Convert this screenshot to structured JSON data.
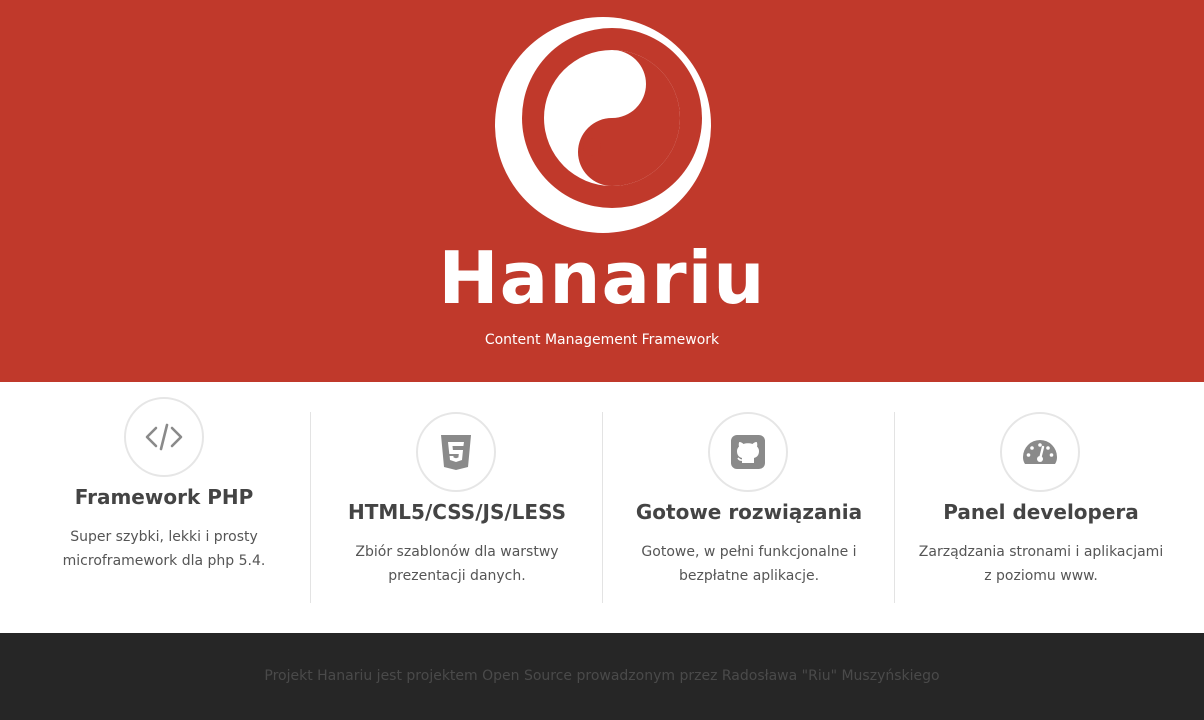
{
  "hero": {
    "brand": "Hanariu",
    "tagline": "Content Management Framework",
    "logo_icon": "yin-yang-logo-icon",
    "background_color": "#c0392b"
  },
  "features": [
    {
      "icon": "code-icon",
      "title": "Framework PHP",
      "description": "Super szybki, lekki i prosty microframework dla php 5.4."
    },
    {
      "icon": "html5-icon",
      "title": "HTML5/CSS/JS/LESS",
      "description": "Zbiór szablonów dla warstwy prezentacji danych."
    },
    {
      "icon": "github-icon",
      "title": "Gotowe rozwiązania",
      "description": "Gotowe, w pełni funkcjonalne i bezpłatne aplikacje."
    },
    {
      "icon": "dashboard-gauge-icon",
      "title": "Panel developera",
      "description": "Zarządzania stronami i aplikacjami z poziomu www."
    }
  ],
  "footer": {
    "text": "Projekt Hanariu jest projektem Open Source prowadzonym przez Radosława \"Riu\" Muszyńskiego",
    "background_color": "#262626"
  }
}
